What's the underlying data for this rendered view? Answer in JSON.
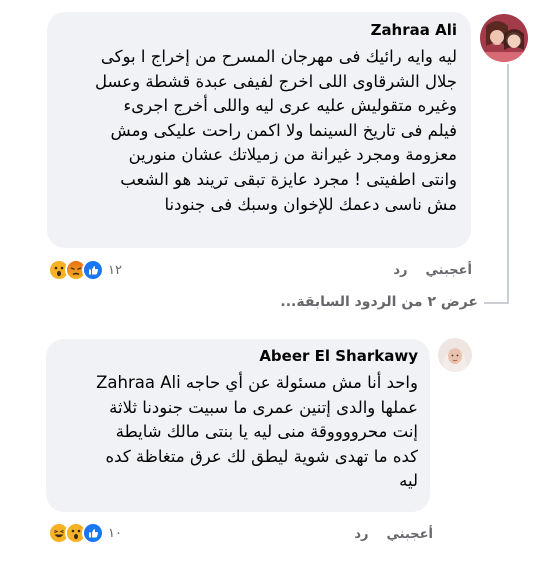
{
  "comment1": {
    "author": "Zahraa Ali",
    "text": "ليه وايه رائيك فى مهرجان المسرح من إخراج ا بوكى\nجلال الشرقاوى اللى اخرج لفيفى عبدة قشطة وعسل\nوغيره متقوليش عليه عرى ليه واللى أخرج اجرىء\nفيلم فى تاريخ السينما ولا اكمن راحت عليكى ومش\nمعزومة ومجرد غيرانة من زميلاتك عشان منورين\nوانتى اطفيتى ! مجرد عايزة تبقى تريند هو الشعب\nمش ناسى دعمك للإخوان وسبك فى جنودنا",
    "like": "أعجبني",
    "reply": "رد",
    "reaction_count": "١٢"
  },
  "view_more": "عرض ٢ من الردود السابقة...",
  "comment2": {
    "author": "Abeer El Sharkawy",
    "text": "واحد أنا مش مسئولة عن أي حاجه Zahraa Ali\nعملها والدى إتنين عمرى ما سبيت جنودنا ثلاثة\nإنت محرووووقة منى ليه يا بنتى مالك شايطة\nكده ما تهدى شوية ليطق لك عرق متغاظة كده\nليه",
    "like": "أعجبني",
    "reply": "رد",
    "reaction_count": "١٠"
  },
  "icons": {
    "comment1_reactions": [
      "wow-icon",
      "angry-icon",
      "like-icon"
    ],
    "comment2_reactions": [
      "haha-icon",
      "wow-icon",
      "like-icon"
    ]
  },
  "colors": {
    "like_blue": "#1877f2",
    "bubble": "#f0f2f5",
    "meta_gray": "#65676b"
  }
}
